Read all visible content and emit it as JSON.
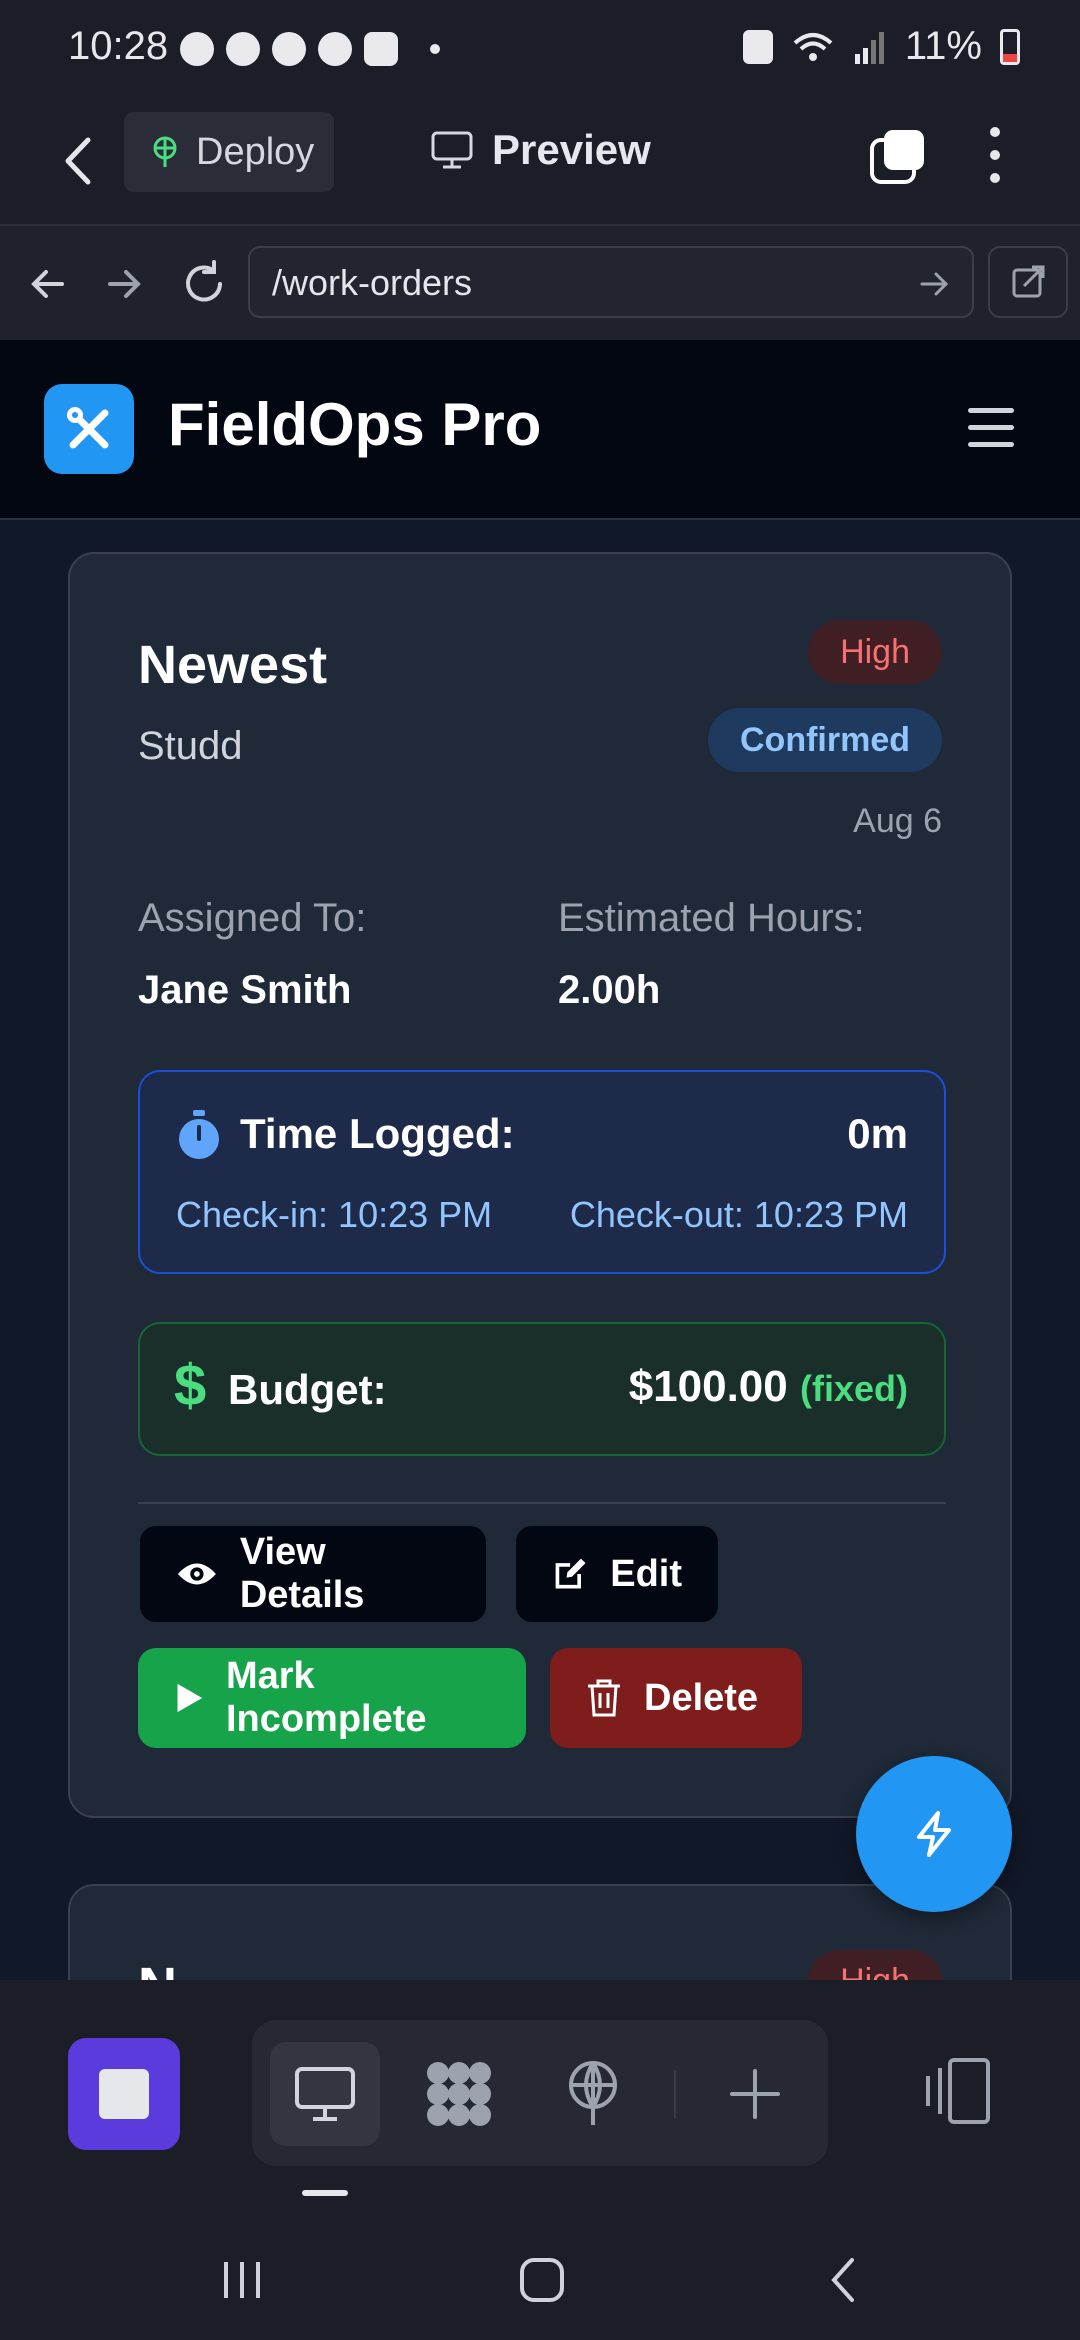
{
  "status_bar": {
    "time": "10:28",
    "battery_percent": "11%"
  },
  "browser": {
    "deploy_label": "Deploy",
    "preview_label": "Preview",
    "url": "/work-orders"
  },
  "app": {
    "title": "FieldOps Pro",
    "accent_color": "#2196f3"
  },
  "work_order": {
    "title": "Newest",
    "client": "Studd",
    "priority": "High",
    "status": "Confirmed",
    "date": "Aug 6",
    "assigned_label": "Assigned To:",
    "assigned_value": "Jane Smith",
    "hours_label": "Estimated Hours:",
    "hours_value": "2.00h",
    "time_logged_label": "Time Logged:",
    "time_logged_value": "0m",
    "check_in": "Check-in: 10:23 PM",
    "check_out": "Check-out: 10:23 PM",
    "budget_label": "Budget:",
    "budget_value": "$100.00",
    "budget_type": "(fixed)",
    "actions": {
      "view": "View Details",
      "edit": "Edit",
      "mark_incomplete": "Mark Incomplete",
      "delete": "Delete"
    }
  },
  "next_card": {
    "title": "N",
    "priority": "High"
  }
}
